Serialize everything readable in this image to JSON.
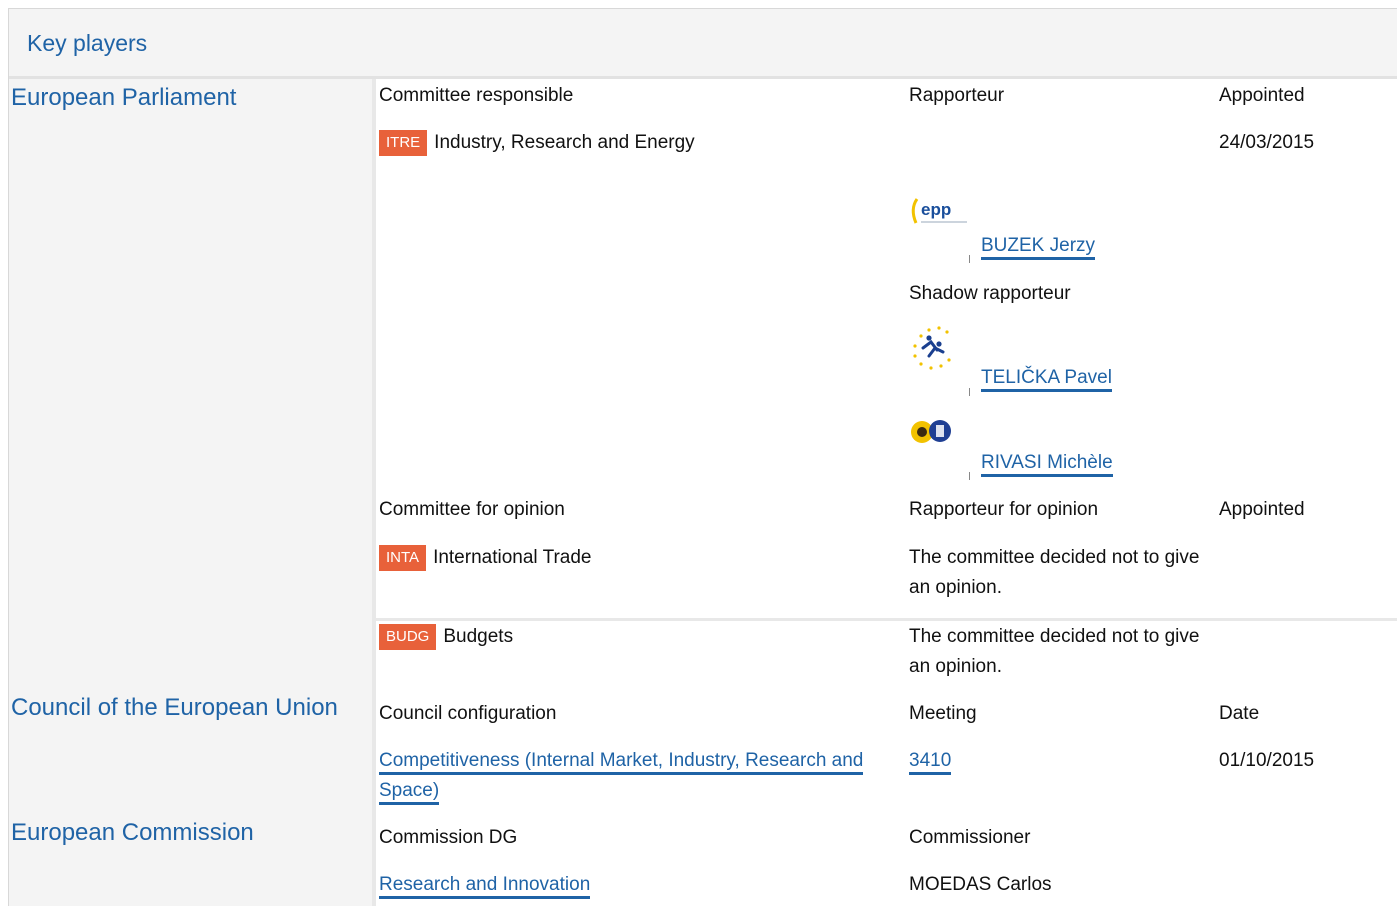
{
  "header": {
    "title": "Key players"
  },
  "sections": {
    "parliament": {
      "label": "European Parliament",
      "responsible": {
        "col1": "Committee responsible",
        "col2": "Rapporteur",
        "col3": "Appointed",
        "committee_code": "ITRE",
        "committee_name": "Industry, Research and Energy",
        "appointed": "24/03/2015",
        "rapporteur": {
          "name": "BUZEK Jerzy",
          "logo_icon": "epp-group-logo-icon"
        },
        "shadow_label": "Shadow rapporteur",
        "shadows": [
          {
            "name": "TELIČKA Pavel",
            "logo_icon": "alde-group-logo-icon"
          },
          {
            "name": "RIVASI Michèle",
            "logo_icon": "greens-efa-group-logo-icon"
          }
        ]
      },
      "opinion": {
        "col1": "Committee for opinion",
        "col2": "Rapporteur for opinion",
        "col3": "Appointed",
        "rows": [
          {
            "code": "INTA",
            "name": "International Trade",
            "decision": "The committee decided not to give an opinion."
          },
          {
            "code": "BUDG",
            "name": "Budgets",
            "decision": "The committee decided not to give an opinion."
          }
        ]
      }
    },
    "council": {
      "label": "Council of the European Union",
      "col1": "Council configuration",
      "col2": "Meeting",
      "col3": "Date",
      "configuration": "Competitiveness (Internal Market, Industry, Research and Space)",
      "meeting": "3410",
      "date": "01/10/2015"
    },
    "commission": {
      "label": "European Commission",
      "col1": "Commission DG",
      "col2": "Commissioner",
      "dg": "Research and Innovation",
      "commissioner": "MOEDAS Carlos"
    }
  },
  "colors": {
    "link": "#1f63a6",
    "badge": "#e8613a",
    "panel_bg": "#f4f4f4"
  }
}
